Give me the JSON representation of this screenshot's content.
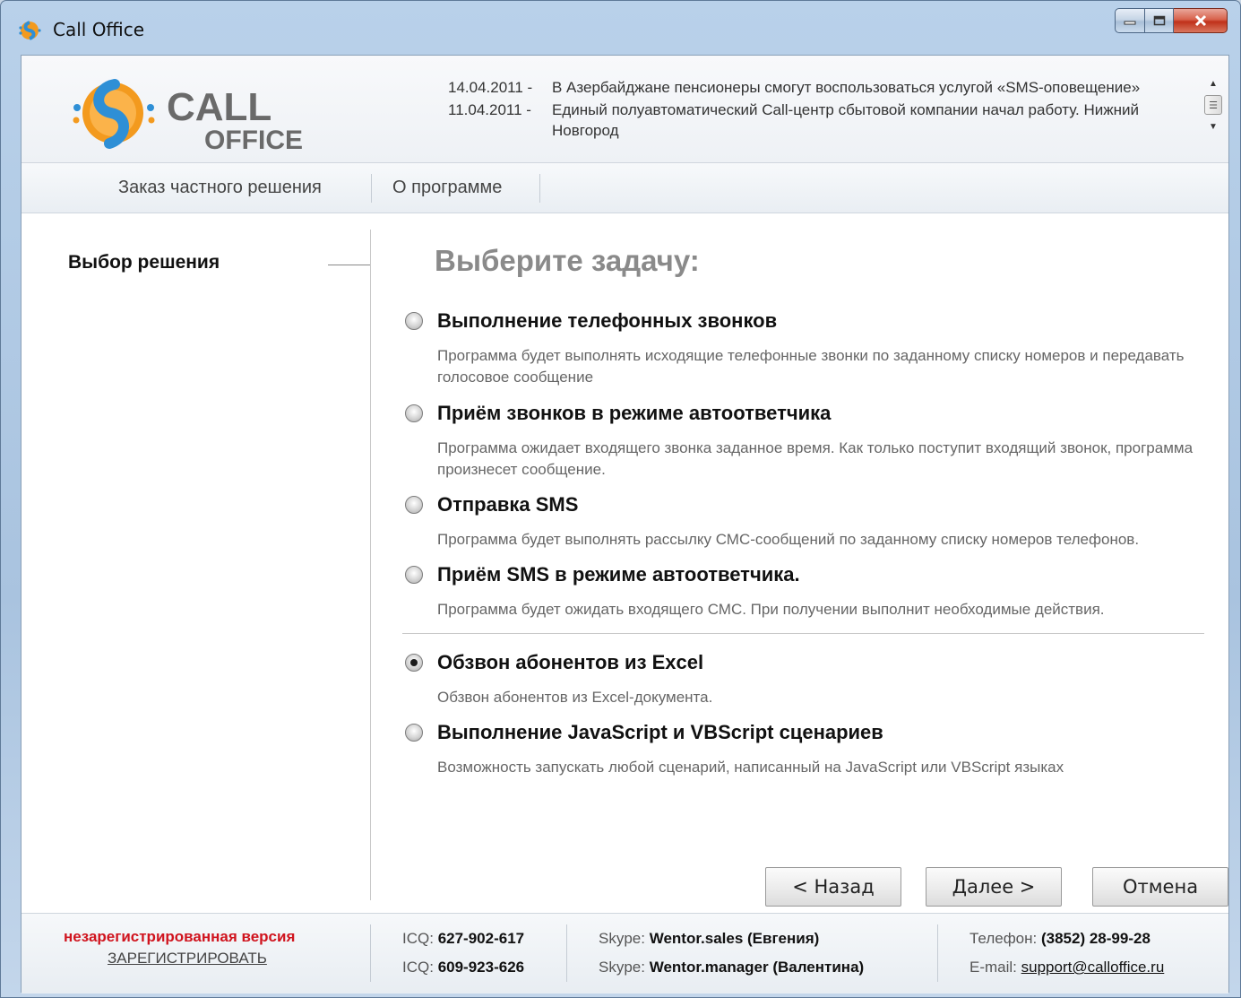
{
  "window": {
    "title": "Call Office"
  },
  "logo": {
    "line1": "CALL",
    "line2": "OFFICE"
  },
  "news": [
    {
      "date": "14.04.2011 -",
      "text": "В Азербайджане пенсионеры смогут воспользоваться услугой «SMS-оповещение»"
    },
    {
      "date": "11.04.2011 -",
      "text": "Единый полуавтоматический Call-центр сбытовой компании начал работу. Нижний Новгород"
    }
  ],
  "nav": {
    "items": [
      "Заказ частного решения",
      "О программе"
    ]
  },
  "sidebar": {
    "step": "Выбор решения"
  },
  "main": {
    "title": "Выберите задачу:",
    "options": [
      {
        "title": "Выполнение телефонных звонков",
        "desc": "Программа будет выполнять исходящие телефонные звонки по заданному списку номеров и передавать голосовое сообщение",
        "checked": false
      },
      {
        "title": "Приём звонков в режиме автоответчика",
        "desc": "Программа ожидает входящего звонка заданное время. Как только поступит входящий звонок, программа произнесет сообщение.",
        "checked": false
      },
      {
        "title": "Отправка SMS",
        "desc": "Программа будет выполнять рассылку СМС-сообщений по заданному списку номеров телефонов.",
        "checked": false
      },
      {
        "title": "Приём SMS в режиме автоответчика.",
        "desc": "Программа будет ожидать входящего СМС. При получении выполнит необходимые действия.",
        "checked": false
      },
      {
        "title": "Обзвон абонентов из Excel",
        "desc": "Обзвон абонентов из Excel-документа.",
        "checked": true
      },
      {
        "title": "Выполнение JavaScript и VBScript сценариев",
        "desc": "Возможность запускать любой сценарий, написанный на JavaScript или VBScript языках",
        "checked": false
      }
    ]
  },
  "buttons": {
    "back": "< Назад",
    "next": "Далее >",
    "cancel": "Отмена"
  },
  "footer": {
    "unregistered": "незарегистрированная версия",
    "register": "ЗАРЕГИСТРИРОВАТЬ",
    "icq_label": "ICQ:",
    "icq1": "627-902-617",
    "icq2": "609-923-626",
    "skype_label": "Skype:",
    "skype1": "Wentor.sales (Евгения)",
    "skype2": "Wentor.manager (Валентина)",
    "phone_label": "Телефон:",
    "phone": "(3852) 28-99-28",
    "email_label": "E-mail:",
    "email": "support@calloffice.ru"
  },
  "colors": {
    "accent_red": "#d0141e",
    "logo_orange": "#f39a1e",
    "logo_blue": "#2e8fd6"
  }
}
